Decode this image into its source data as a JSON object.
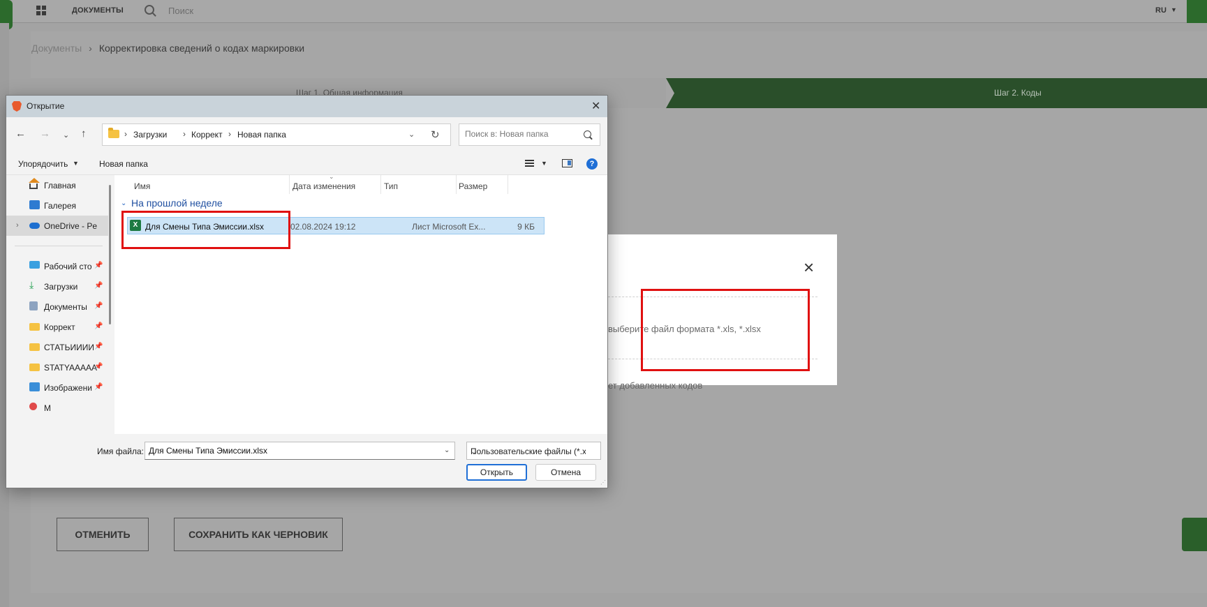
{
  "app": {
    "nav_tab": "ДОКУМЕНТЫ",
    "search_placeholder": "Поиск",
    "language": "RU",
    "breadcrumb": {
      "root": "Документы",
      "current": "Корректировка сведений о кодах маркировки"
    },
    "steps": {
      "step1": "Шаг 1. Общая информация",
      "step2": "Шаг 2. Коды"
    },
    "upload_modal": {
      "hint": "выберите файл формата *.xls, *.xlsx",
      "under_text": "ет добавленных кодов"
    },
    "buttons": {
      "cancel": "ОТМЕНИТЬ",
      "save_draft": "СОХРАНИТЬ КАК ЧЕРНОВИК"
    },
    "colors": {
      "brand_green": "#2c6a2c",
      "highlight_red": "#e01010"
    }
  },
  "dialog": {
    "title": "Открытие",
    "address": {
      "crumbs": [
        "Загрузки",
        "Коррект",
        "Новая папка"
      ]
    },
    "search_placeholder": "Поиск в: Новая папка",
    "toolbar": {
      "organize": "Упорядочить",
      "new_folder": "Новая папка"
    },
    "nav_items": [
      {
        "label": "Главная",
        "icon": "home-icon"
      },
      {
        "label": "Галерея",
        "icon": "gallery-icon"
      },
      {
        "label": "OneDrive - Persc",
        "icon": "onedrive-icon"
      },
      {
        "label": "Рабочий сто",
        "icon": "desktop-icon"
      },
      {
        "label": "Загрузки",
        "icon": "download-icon"
      },
      {
        "label": "Документы",
        "icon": "documents-icon"
      },
      {
        "label": "Коррект",
        "icon": "folder-icon"
      },
      {
        "label": "СТАТЬИИИИ",
        "icon": "folder-icon"
      },
      {
        "label": "STATYAAAAA",
        "icon": "folder-icon"
      },
      {
        "label": "Изображени",
        "icon": "pictures-icon"
      },
      {
        "label": "М",
        "icon": "music-icon"
      }
    ],
    "columns": [
      "Имя",
      "Дата изменения",
      "Тип",
      "Размер"
    ],
    "group_label": "На прошлой неделе",
    "files": [
      {
        "name": "Для Смены Типа Эмиссии.xlsx",
        "date": "02.08.2024 19:12",
        "type": "Лист Microsoft Ex...",
        "size": "9 КБ"
      }
    ],
    "filename_label": "Имя файла:",
    "filename_value": "Для Смены Типа Эмиссии.xlsx",
    "filetype_value": "Пользовательские файлы (*.x",
    "open_button": "Открыть",
    "cancel_button": "Отмена"
  }
}
